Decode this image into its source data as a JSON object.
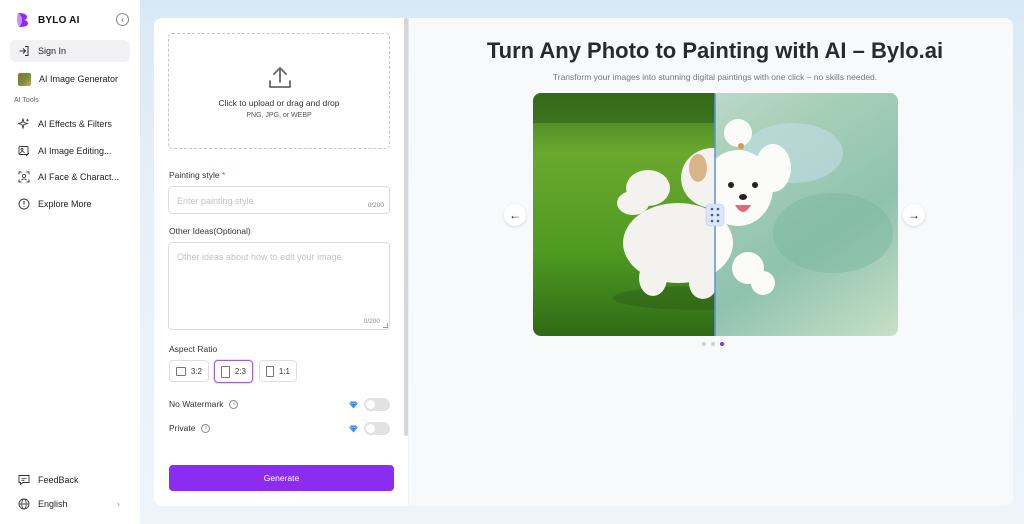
{
  "brand": {
    "name": "BYLO AI"
  },
  "sidebar": {
    "sign_in": "Sign In",
    "generator": "AI Image Generator",
    "section_label": "AI Tools",
    "items": [
      {
        "label": "AI Effects & Filters",
        "icon": "sparkle-icon"
      },
      {
        "label": "AI Image Editing...",
        "icon": "image-edit-icon"
      },
      {
        "label": "AI Face & Charact...",
        "icon": "face-scan-icon"
      },
      {
        "label": "Explore More",
        "icon": "compass-icon"
      }
    ],
    "feedback": "FeedBack",
    "language": "English"
  },
  "form": {
    "upload_text": "Click to upload or drag and drop",
    "upload_formats": "PNG, JPG, or WEBP",
    "painting_style_label": "Painting style",
    "required_mark": "*",
    "painting_style_placeholder": "Enter painting style",
    "painting_style_counter": "0/200",
    "other_ideas_label": "Other Ideas(Optional)",
    "other_ideas_placeholder": "Other ideas about how to edit your image",
    "other_ideas_counter": "0/200",
    "aspect_ratio_label": "Aspect Ratio",
    "ratios": [
      "3:2",
      "2:3",
      "1:1"
    ],
    "selected_ratio": "2:3",
    "no_watermark_label": "No Watermark",
    "private_label": "Private",
    "no_watermark_on": false,
    "private_on": false,
    "generate_label": "Generate"
  },
  "preview": {
    "title": "Turn Any Photo to Painting with AI – Bylo.ai",
    "subtitle": "Transform your images into stunning digital paintings with one click – no skills needed.",
    "prev_arrow": "←",
    "next_arrow": "→",
    "slides": 3,
    "active_slide": 3
  },
  "colors": {
    "accent": "#8b2cf0",
    "selected_border": "#9b5de5",
    "background": "#e6f0f8"
  }
}
